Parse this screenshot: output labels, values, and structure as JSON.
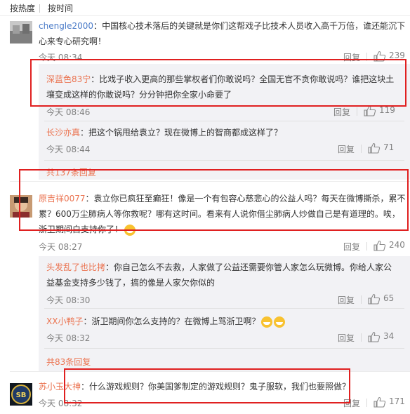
{
  "sort": {
    "hot": "按热度",
    "time": "按时间"
  },
  "comments": [
    {
      "user": "chengle2000",
      "text_line1": "：中国核心技术落后的关键就是你们这帮戏子比技术人员收入高千万倍，谁还能沉下",
      "text_line2": "心来专心研究啊！",
      "time": "今天 08:34",
      "reply": "回复",
      "likes": "239"
    },
    {
      "user": "原吉祥0077",
      "text_line1": "：袁立你已疯狂至癫狂！像是一个有包容心慈悲心的公益人吗？每天在微博撕杀，累不",
      "text_line2": "累？600万尘肺病人等你救呢？哪有这时间。看来有人说你借尘肺病人炒做自己是有道理的。唉，",
      "text_line3": "浙卫期间白支持你了！",
      "time": "今天 08:27",
      "reply": "回复",
      "likes": "240"
    },
    {
      "user": "苏小玉大神",
      "text_line1": "：什么游戏规则？你美国爹制定的游戏规则？鬼子服软，我们也要照做？",
      "time": "今天 08:32",
      "reply": "回复",
      "likes": "171"
    }
  ],
  "replies_group1": [
    {
      "user": "深蓝色83宁",
      "text_line1": "：比戏子收入更高的那些掌权者们你敢说吗？全国无官不贪你敢说吗？谁把这块土",
      "text_line2": "壤变成这样的你敢说吗？分分钟把你全家小命要了",
      "time": "今天 08:46",
      "reply": "回复",
      "likes": "119"
    },
    {
      "user": "长沙亦真",
      "text_line1": "：把这个锅甩给袁立？现在微博上的智商都成这样了？",
      "time": "今天 08:44",
      "reply": "回复",
      "likes": "71"
    }
  ],
  "more_group1": "共137条回复",
  "replies_group2": [
    {
      "user": "头发乱了也比拷",
      "text_line1": "：你自己怎么不去救，人家做了公益还需要你管人家怎么玩微博。你给人家公",
      "text_line2": "益基金支持多少钱了，搞的像是人家欠你似的",
      "time": "今天 08:30",
      "reply": "回复",
      "likes": "65"
    },
    {
      "user": "XX小鸭子",
      "text_line1": "：浙卫期间你怎么支持的？在微博上骂浙卫啊？",
      "time": "今天 08:32",
      "reply": "回复",
      "likes": "34"
    }
  ],
  "more_group2": "共83条回复",
  "avatar3_text": "SB"
}
